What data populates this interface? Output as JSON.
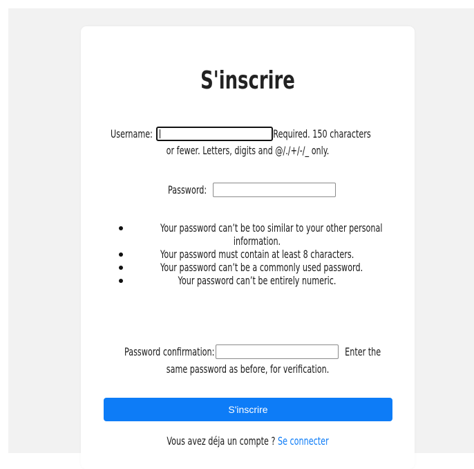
{
  "page": {
    "title": "S'inscrire"
  },
  "username": {
    "label": "Username:",
    "help_line1": "Required. 150 characters",
    "help_line2": "or fewer. Letters, digits and @/./+/-/_ only."
  },
  "password": {
    "label": "Password:",
    "rules": [
      "Your password can’t be too similar to your other personal",
      "information.",
      "Your password must contain at least 8 characters.",
      "Your password can’t be a commonly used password.",
      "Your password can’t be entirely numeric."
    ]
  },
  "password_confirmation": {
    "label": "Password confirmation:",
    "help_line1": "Enter the",
    "help_line2": "same password as before, for verification."
  },
  "submit": {
    "label": "S'inscrire"
  },
  "footer": {
    "text": "Vous avez déja un compte ?",
    "link_label": "Se connecter"
  },
  "colors": {
    "accent": "#0d7cf7",
    "background": "#f2f2f2",
    "card": "#ffffff"
  }
}
